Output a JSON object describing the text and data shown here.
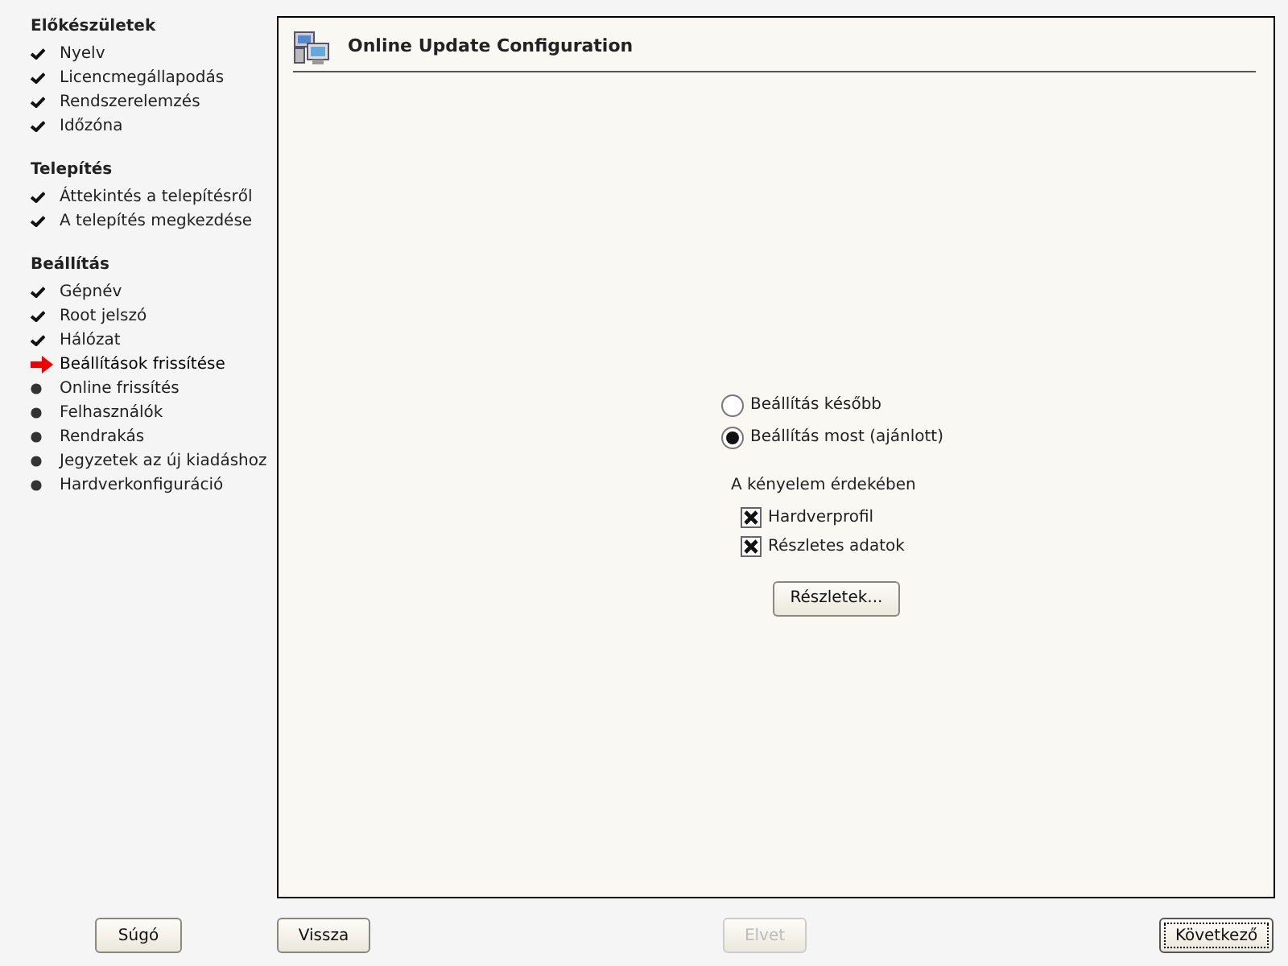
{
  "sidebar": {
    "sections": [
      {
        "title": "Előkészületek",
        "items": [
          {
            "label": "Nyelv",
            "kind": "done"
          },
          {
            "label": "Licencmegállapodás",
            "kind": "done"
          },
          {
            "label": "Rendszerelemzés",
            "kind": "done"
          },
          {
            "label": "Időzóna",
            "kind": "done"
          }
        ]
      },
      {
        "title": "Telepítés",
        "items": [
          {
            "label": "Áttekintés a telepítésről",
            "kind": "done"
          },
          {
            "label": "A telepítés megkezdése",
            "kind": "done"
          }
        ]
      },
      {
        "title": "Beállítás",
        "items": [
          {
            "label": "Gépnév",
            "kind": "done"
          },
          {
            "label": "Root jelszó",
            "kind": "done"
          },
          {
            "label": "Hálózat",
            "kind": "done"
          },
          {
            "label": "Beállítások frissítése",
            "kind": "current"
          },
          {
            "label": "Online frissítés",
            "kind": "pending"
          },
          {
            "label": "Felhasználók",
            "kind": "pending"
          },
          {
            "label": "Rendrakás",
            "kind": "pending"
          },
          {
            "label": "Jegyzetek az új kiadáshoz",
            "kind": "pending"
          },
          {
            "label": "Hardverkonfiguráció",
            "kind": "pending"
          }
        ]
      }
    ]
  },
  "panel": {
    "title": "Online Update Configuration",
    "radios": [
      {
        "label": "Beállítás később",
        "selected": false
      },
      {
        "label": "Beállítás most (ajánlott)",
        "selected": true
      }
    ],
    "group_label": "A kényelem érdekében",
    "checkboxes": [
      {
        "label": "Hardverprofil",
        "checked": true
      },
      {
        "label": "Részletes adatok",
        "checked": true
      }
    ],
    "details_button": "Részletek..."
  },
  "buttons": [
    {
      "label": "Súgó",
      "disabled": false,
      "focused": false
    },
    {
      "label": "Vissza",
      "disabled": false,
      "focused": false
    },
    {
      "label": "Elvet",
      "disabled": true,
      "focused": false
    },
    {
      "label": "Következő",
      "disabled": false,
      "focused": true
    }
  ]
}
